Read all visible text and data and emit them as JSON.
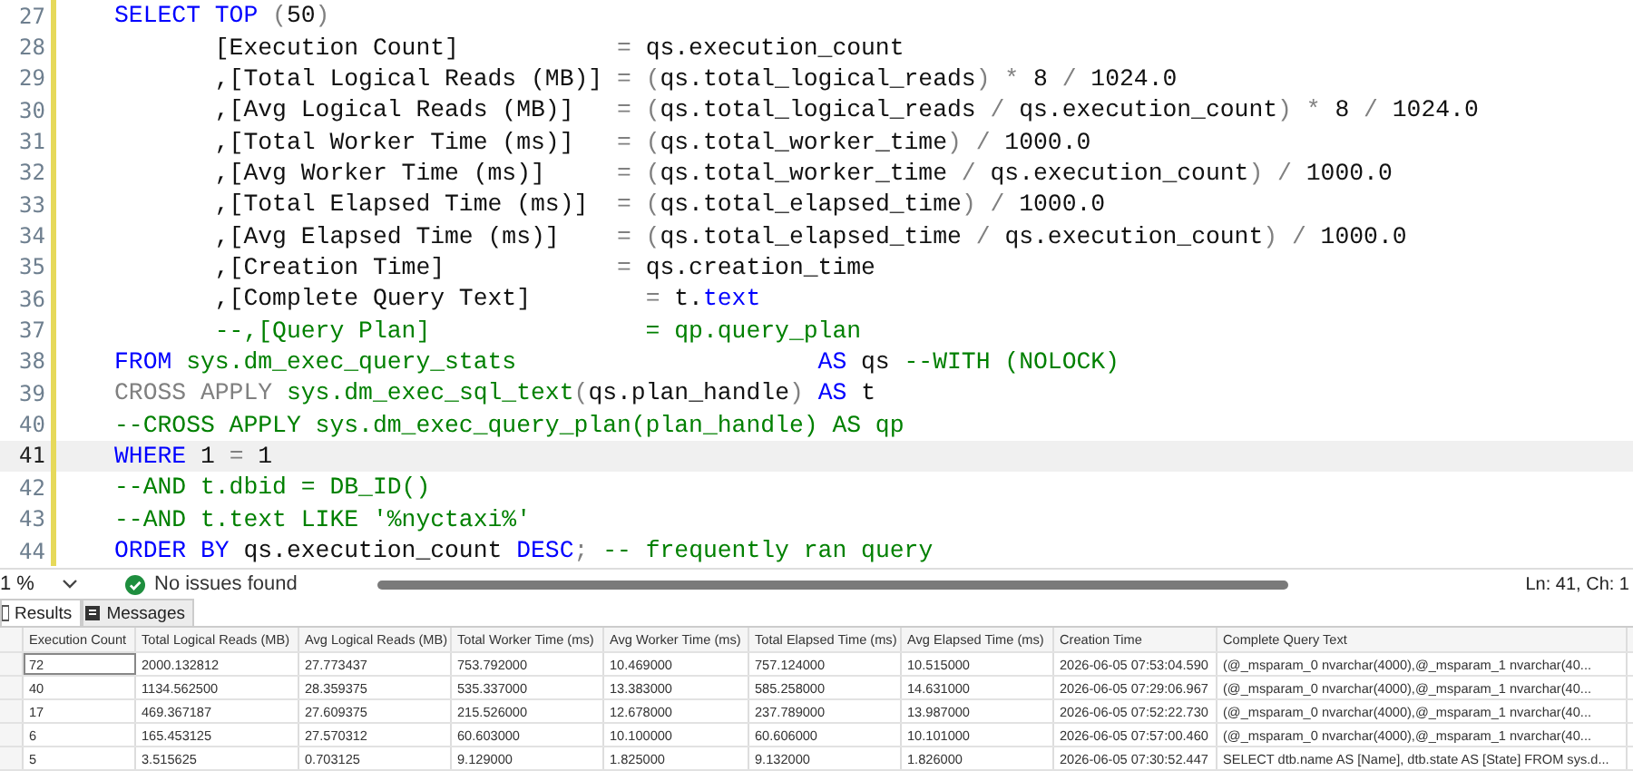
{
  "editor": {
    "lines": [
      {
        "number": "27",
        "current": false,
        "tokens": [
          {
            "t": "SELECT TOP",
            "kind": "kw"
          },
          {
            "t": " (",
            "kind": "op"
          },
          {
            "t": "50",
            "kind": "id"
          },
          {
            "t": ")",
            "kind": "op"
          }
        ]
      },
      {
        "number": "28",
        "current": false,
        "tokens": [
          {
            "t": "       [Execution Count]           ",
            "kind": "id"
          },
          {
            "t": "= ",
            "kind": "op"
          },
          {
            "t": "qs.execution_count",
            "kind": "id"
          }
        ]
      },
      {
        "number": "29",
        "current": false,
        "tokens": [
          {
            "t": "       ,[Total Logical Reads (MB)]",
            "kind": "id"
          },
          {
            "t": " = (",
            "kind": "op"
          },
          {
            "t": "qs.total_logical_reads",
            "kind": "id"
          },
          {
            "t": ") * ",
            "kind": "op"
          },
          {
            "t": "8",
            "kind": "id"
          },
          {
            "t": " / ",
            "kind": "op"
          },
          {
            "t": "1024.0",
            "kind": "id"
          }
        ]
      },
      {
        "number": "30",
        "current": false,
        "tokens": [
          {
            "t": "       ,[Avg Logical Reads (MB)]",
            "kind": "id"
          },
          {
            "t": "   = (",
            "kind": "op"
          },
          {
            "t": "qs.total_logical_reads",
            "kind": "id"
          },
          {
            "t": " / ",
            "kind": "op"
          },
          {
            "t": "qs.execution_count",
            "kind": "id"
          },
          {
            "t": ") * ",
            "kind": "op"
          },
          {
            "t": "8",
            "kind": "id"
          },
          {
            "t": " / ",
            "kind": "op"
          },
          {
            "t": "1024.0",
            "kind": "id"
          }
        ]
      },
      {
        "number": "31",
        "current": false,
        "tokens": [
          {
            "t": "       ,[Total Worker Time (ms)]",
            "kind": "id"
          },
          {
            "t": "   = (",
            "kind": "op"
          },
          {
            "t": "qs.total_worker_time",
            "kind": "id"
          },
          {
            "t": ") / ",
            "kind": "op"
          },
          {
            "t": "1000.0",
            "kind": "id"
          }
        ]
      },
      {
        "number": "32",
        "current": false,
        "tokens": [
          {
            "t": "       ,[Avg Worker Time (ms)]",
            "kind": "id"
          },
          {
            "t": "     = (",
            "kind": "op"
          },
          {
            "t": "qs.total_worker_time",
            "kind": "id"
          },
          {
            "t": " / ",
            "kind": "op"
          },
          {
            "t": "qs.execution_count",
            "kind": "id"
          },
          {
            "t": ") / ",
            "kind": "op"
          },
          {
            "t": "1000.0",
            "kind": "id"
          }
        ]
      },
      {
        "number": "33",
        "current": false,
        "tokens": [
          {
            "t": "       ,[Total Elapsed Time (ms)]",
            "kind": "id"
          },
          {
            "t": "  = (",
            "kind": "op"
          },
          {
            "t": "qs.total_elapsed_time",
            "kind": "id"
          },
          {
            "t": ") / ",
            "kind": "op"
          },
          {
            "t": "1000.0",
            "kind": "id"
          }
        ]
      },
      {
        "number": "34",
        "current": false,
        "tokens": [
          {
            "t": "       ,[Avg Elapsed Time (ms)]",
            "kind": "id"
          },
          {
            "t": "    = (",
            "kind": "op"
          },
          {
            "t": "qs.total_elapsed_time",
            "kind": "id"
          },
          {
            "t": " / ",
            "kind": "op"
          },
          {
            "t": "qs.execution_count",
            "kind": "id"
          },
          {
            "t": ") / ",
            "kind": "op"
          },
          {
            "t": "1000.0",
            "kind": "id"
          }
        ]
      },
      {
        "number": "35",
        "current": false,
        "tokens": [
          {
            "t": "       ,[Creation Time]            ",
            "kind": "id"
          },
          {
            "t": "= ",
            "kind": "op"
          },
          {
            "t": "qs.creation_time",
            "kind": "id"
          }
        ]
      },
      {
        "number": "36",
        "current": false,
        "tokens": [
          {
            "t": "       ,[Complete Query Text]        ",
            "kind": "id"
          },
          {
            "t": "= ",
            "kind": "op"
          },
          {
            "t": "t.",
            "kind": "id"
          },
          {
            "t": "text",
            "kind": "kw"
          }
        ]
      },
      {
        "number": "37",
        "current": false,
        "tokens": [
          {
            "t": "       --,[Query Plan]               = qp.query_plan",
            "kind": "cm"
          }
        ]
      },
      {
        "number": "38",
        "current": false,
        "tokens": [
          {
            "t": "FROM",
            "kind": "kw"
          },
          {
            "t": " sys.dm_exec_query_stats                     ",
            "kind": "sys"
          },
          {
            "t": "AS",
            "kind": "kw"
          },
          {
            "t": " qs ",
            "kind": "id"
          },
          {
            "t": "--WITH (NOLOCK)",
            "kind": "cm"
          }
        ]
      },
      {
        "number": "39",
        "current": false,
        "tokens": [
          {
            "t": "CROSS APPLY",
            "kind": "fn"
          },
          {
            "t": " sys.dm_exec_sql_text",
            "kind": "sys"
          },
          {
            "t": "(",
            "kind": "op"
          },
          {
            "t": "qs.plan_handle",
            "kind": "id"
          },
          {
            "t": ")",
            "kind": "op"
          },
          {
            "t": " AS",
            "kind": "kw"
          },
          {
            "t": " t",
            "kind": "id"
          }
        ]
      },
      {
        "number": "40",
        "current": false,
        "tokens": [
          {
            "t": "--CROSS APPLY sys.dm_exec_query_plan(plan_handle) AS qp",
            "kind": "cm"
          }
        ]
      },
      {
        "number": "41",
        "current": true,
        "tokens": [
          {
            "t": "WHERE",
            "kind": "kw"
          },
          {
            "t": " 1 ",
            "kind": "id"
          },
          {
            "t": "=",
            "kind": "op"
          },
          {
            "t": " 1",
            "kind": "id"
          }
        ]
      },
      {
        "number": "42",
        "current": false,
        "tokens": [
          {
            "t": "--AND t.dbid = DB_ID()",
            "kind": "cm"
          }
        ]
      },
      {
        "number": "43",
        "current": false,
        "tokens": [
          {
            "t": "--AND t.text LIKE '%nyctaxi%'",
            "kind": "cm"
          }
        ]
      },
      {
        "number": "44",
        "current": false,
        "tokens": [
          {
            "t": "ORDER BY",
            "kind": "kw"
          },
          {
            "t": " qs.execution_count ",
            "kind": "id"
          },
          {
            "t": "DESC",
            "kind": "kw"
          },
          {
            "t": ";",
            "kind": "op"
          },
          {
            "t": " -- frequently ran query",
            "kind": "cm"
          }
        ]
      }
    ]
  },
  "status_bar": {
    "zoom": "1 %",
    "issues": "No issues found",
    "position": "Ln: 41, Ch: 1"
  },
  "tabs": [
    {
      "label": "Results",
      "selected": true
    },
    {
      "label": "Messages",
      "selected": false
    }
  ],
  "table": {
    "columns": [
      "Execution Count",
      "Total Logical Reads (MB)",
      "Avg Logical Reads (MB)",
      "Total Worker Time (ms)",
      "Avg Worker Time (ms)",
      "Total Elapsed Time (ms)",
      "Avg Elapsed Time (ms)",
      "Creation Time",
      "Complete Query Text"
    ],
    "rows": [
      {
        "selected": true,
        "cells": [
          "72",
          "2000.132812",
          "27.773437",
          "753.792000",
          "10.469000",
          "757.124000",
          "10.515000",
          "2026-06-05 07:53:04.590",
          "(@_msparam_0 nvarchar(4000),@_msparam_1 nvarchar(40..."
        ]
      },
      {
        "selected": false,
        "cells": [
          "40",
          "1134.562500",
          "28.359375",
          "535.337000",
          "13.383000",
          "585.258000",
          "14.631000",
          "2026-06-05 07:29:06.967",
          "(@_msparam_0 nvarchar(4000),@_msparam_1 nvarchar(40..."
        ]
      },
      {
        "selected": false,
        "cells": [
          "17",
          "469.367187",
          "27.609375",
          "215.526000",
          "12.678000",
          "237.789000",
          "13.987000",
          "2026-06-05 07:52:22.730",
          "(@_msparam_0 nvarchar(4000),@_msparam_1 nvarchar(40..."
        ]
      },
      {
        "selected": false,
        "cells": [
          "6",
          "165.453125",
          "27.570312",
          "60.603000",
          "10.100000",
          "60.606000",
          "10.101000",
          "2026-06-05 07:57:00.460",
          "(@_msparam_0 nvarchar(4000),@_msparam_1 nvarchar(40..."
        ]
      },
      {
        "selected": false,
        "cells": [
          "5",
          "3.515625",
          "0.703125",
          "9.129000",
          "1.825000",
          "9.132000",
          "1.826000",
          "2026-06-05 07:30:52.447",
          "SELECT dtb.name AS [Name], dtb.state AS [State] FROM sys.d..."
        ]
      }
    ]
  }
}
